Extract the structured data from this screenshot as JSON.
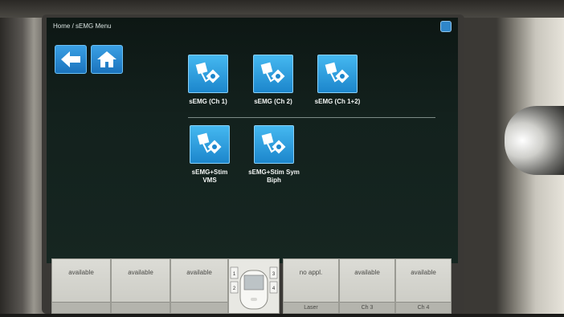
{
  "breadcrumb": "Home / sEMG Menu",
  "apps": [
    {
      "label": "sEMG (Ch 1)"
    },
    {
      "label": "sEMG (Ch 2)"
    },
    {
      "label": "sEMG (Ch 1+2)"
    },
    {
      "label": "sEMG+Stim\nVMS"
    },
    {
      "label": "sEMG+Stim Sym\nBiph"
    }
  ],
  "slots": [
    {
      "status": "available",
      "footer": ""
    },
    {
      "status": "available",
      "footer": ""
    },
    {
      "status": "available",
      "footer": ""
    },
    {
      "status": "no appl.",
      "footer": "Laser"
    },
    {
      "status": "available",
      "footer": "Ch 3"
    },
    {
      "status": "available",
      "footer": "Ch 4"
    }
  ],
  "device": {
    "channels": [
      "1",
      "2",
      "3",
      "4"
    ]
  },
  "colors": {
    "accent": "#2f97dc",
    "screen_bg": "#13211d"
  },
  "icons": [
    "back-arrow-icon",
    "home-icon",
    "electrode-icon",
    "window-icon"
  ]
}
